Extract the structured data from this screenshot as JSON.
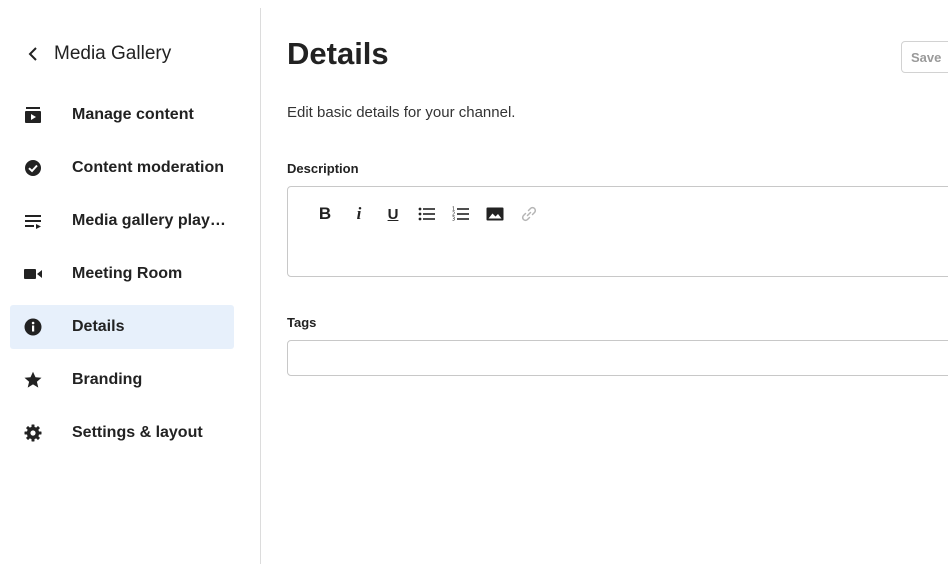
{
  "sidebar": {
    "back_label": "Media Gallery",
    "items": [
      {
        "label": "Manage content",
        "icon": "play-playlist-icon",
        "active": false
      },
      {
        "label": "Content moderation",
        "icon": "check-circle-icon",
        "active": false
      },
      {
        "label": "Media gallery play…",
        "icon": "queue-music-icon",
        "active": false
      },
      {
        "label": "Meeting Room",
        "icon": "video-camera-icon",
        "active": false
      },
      {
        "label": "Details",
        "icon": "info-icon",
        "active": true
      },
      {
        "label": "Branding",
        "icon": "star-icon",
        "active": false
      },
      {
        "label": "Settings & layout",
        "icon": "gear-icon",
        "active": false
      }
    ]
  },
  "main": {
    "title": "Details",
    "save_label": "Save",
    "subtitle": "Edit basic details for your channel.",
    "description_label": "Description",
    "description_value": "",
    "tags_label": "Tags",
    "tags_value": "",
    "toolbar": {
      "bold": "B",
      "italic": "i",
      "underline": "U"
    }
  },
  "colors": {
    "active_bg": "#e7f0fb",
    "text": "#222222",
    "border": "#c8c8c8",
    "disabled_text": "#9a9a9a"
  }
}
